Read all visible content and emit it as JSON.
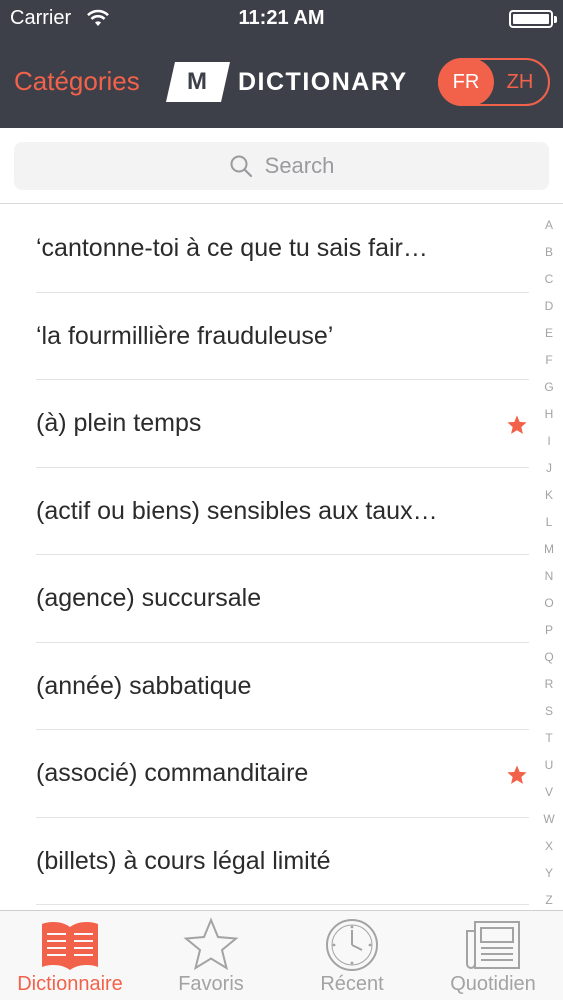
{
  "status_bar": {
    "carrier": "Carrier",
    "time": "11:21 AM"
  },
  "nav": {
    "categories_label": "Catégories",
    "logo_mark": "M",
    "logo_text": "DICTIONARY",
    "lang_active": "FR",
    "lang_other": "ZH"
  },
  "search": {
    "placeholder": "Search"
  },
  "entries": [
    {
      "term": "‘cantonne-toi à ce que tu sais fair…",
      "starred": false
    },
    {
      "term": "‘la fourmillière frauduleuse’",
      "starred": false
    },
    {
      "term": "(à) plein temps",
      "starred": true
    },
    {
      "term": "(actif ou biens) sensibles aux taux…",
      "starred": false
    },
    {
      "term": "(agence) succursale",
      "starred": false
    },
    {
      "term": "(année) sabbatique",
      "starred": false
    },
    {
      "term": "(associé) commanditaire",
      "starred": true
    },
    {
      "term": "(billets) à cours légal limité",
      "starred": false
    }
  ],
  "index_letters": [
    "A",
    "B",
    "C",
    "D",
    "E",
    "F",
    "G",
    "H",
    "I",
    "J",
    "K",
    "L",
    "M",
    "N",
    "O",
    "P",
    "Q",
    "R",
    "S",
    "T",
    "U",
    "V",
    "W",
    "X",
    "Y",
    "Z"
  ],
  "tabs": [
    {
      "label": "Dictionnaire",
      "icon": "book-icon",
      "active": true
    },
    {
      "label": "Favoris",
      "icon": "star-icon",
      "active": false
    },
    {
      "label": "Récent",
      "icon": "clock-icon",
      "active": false
    },
    {
      "label": "Quotidien",
      "icon": "newspaper-icon",
      "active": false
    }
  ],
  "colors": {
    "accent": "#f2624b",
    "nav_bg": "#3e4049",
    "inactive": "#a3a3a3"
  }
}
